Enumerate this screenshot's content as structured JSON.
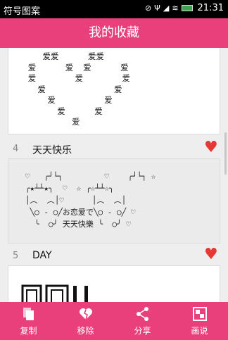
{
  "status_bar": {
    "app_name": "符号图案",
    "time": "21:31",
    "icons": [
      "no-sim-icon",
      "usb-icon",
      "signal-icon",
      "wifi-icon",
      "battery-icon"
    ]
  },
  "header": {
    "title": "我的收藏"
  },
  "items": [
    {
      "art": "       爱爱      爱爱\n    爱      爱  爱      爱\n    爱        爱        爱\n      爱              爱\n        爱          爱\n          爱      爱\n             爱"
    },
    {
      "number": "4",
      "title": "天天快乐",
      "art": "   ♡   ╭┘└┐         ♡    ╭┘└┐ ☆\n   ╭★┴┴★╮  ♡  ☆ ╭☆┴┴☆╮\n   │︵  ︵│♡      │︵  ︵│\n    ╲○ - ○╱お恋爱で╲○ - ○╱ ♡\n     ╰  ○╯ 天天快樂 ╰  ○╯ ♡"
    },
    {
      "number": "5",
      "title": "DAY"
    }
  ],
  "bottom_bar": [
    {
      "label": "复制",
      "icon": "copy-icon"
    },
    {
      "label": "移除",
      "icon": "broken-heart-icon"
    },
    {
      "label": "分享",
      "icon": "share-icon"
    },
    {
      "label": "画说",
      "icon": "canvas-icon"
    }
  ],
  "colors": {
    "accent": "#e9407b",
    "heart": "#e53935"
  }
}
